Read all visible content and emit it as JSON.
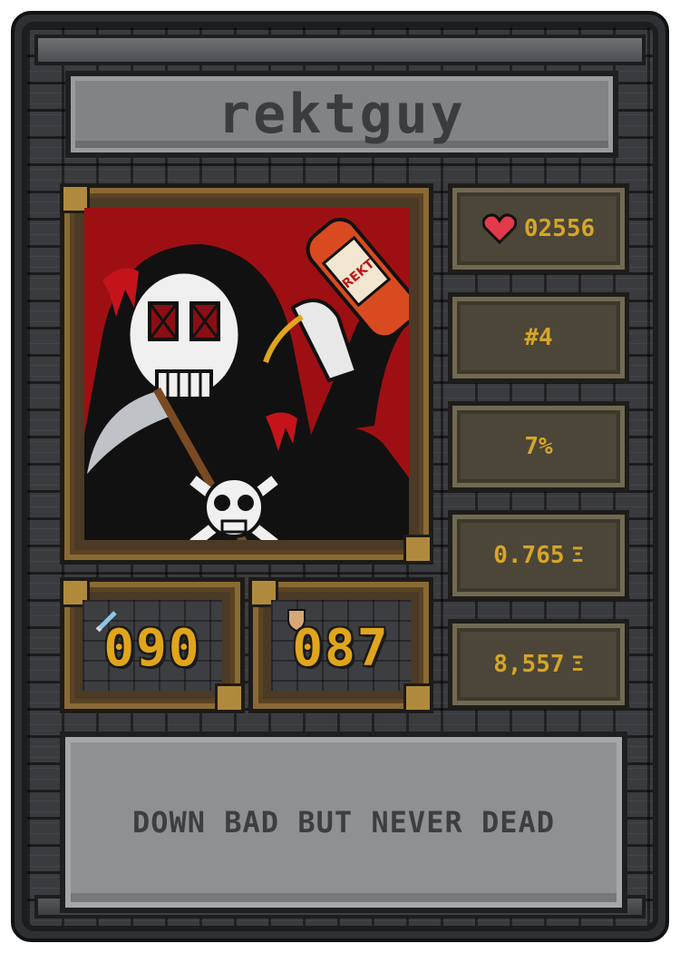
{
  "card": {
    "name": "rektguy",
    "bottle_label": "REKT",
    "stats": {
      "hearts": "02556",
      "rank": "#4",
      "percent": "7%",
      "price": "0.765",
      "volume": "8,557"
    },
    "currency_symbol": "Ξ",
    "attack": "090",
    "defense": "087",
    "quote": "DOWN BAD BUT NEVER DEAD"
  },
  "icons": {
    "heart": "heart-icon",
    "sword": "sword-icon",
    "shield": "shield-icon"
  },
  "colors": {
    "accent_gold": "#d6a52a",
    "art_background": "#9e0f14",
    "heart_red": "#e23a4a"
  }
}
